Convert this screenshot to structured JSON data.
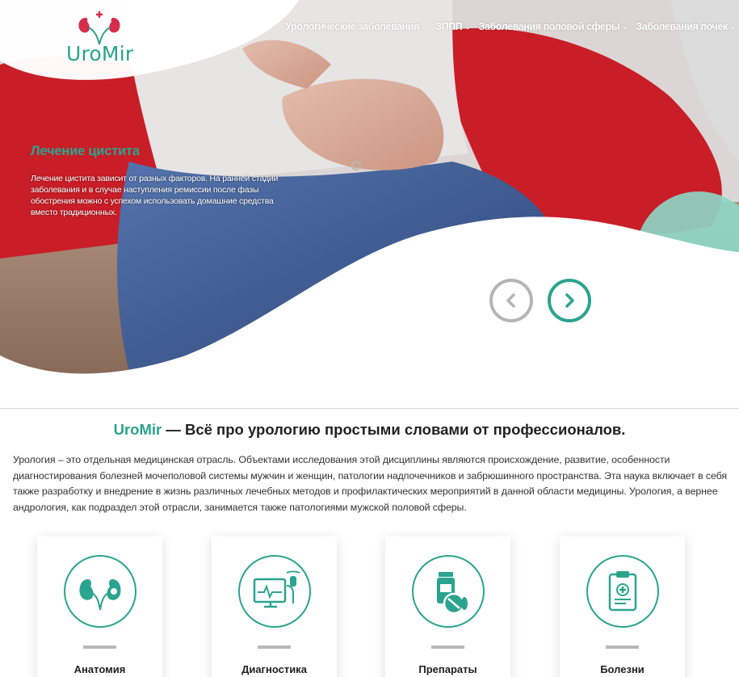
{
  "brand": {
    "logo_text": "UroMir"
  },
  "nav": {
    "items": [
      {
        "label": "Урологические заболевания"
      },
      {
        "label": "ЗППП"
      },
      {
        "label": "Заболевания половой сферы"
      },
      {
        "label": "Заболевания почек"
      }
    ]
  },
  "slider": {
    "title": "Лечение цистита",
    "text": "Лечение цистита зависит от разных факторов. На ранней стадии заболевания и в случае наступления ремиссии после фазы обострения можно с успехом использовать домашние средства вместо традиционных."
  },
  "main": {
    "headline_brand": "UroMir",
    "headline_rest": " — Всё про урологию простыми словами от профессионалов.",
    "intro": "Урология – это отдельная медицинская отрасль. Объектами исследования этой дисциплины являются происхождение, развитие, особенности диагностирования болезней мочеполовой системы мужчин и женщин, патологии надпочечников и забрюшинного пространства. Эта наука включает в себя также разработку и внедрение в жизнь различных лечебных методов и профилактических мероприятий в данной области медицины. Урология, а вернее андрология, как подраздел этой отрасли, занимается также патологиями мужской половой сферы."
  },
  "cards": [
    {
      "label": "Анатомия",
      "icon": "kidneys-icon"
    },
    {
      "label": "Диагностика",
      "icon": "ultrasound-monitor-icon"
    },
    {
      "label": "Препараты",
      "icon": "pills-icon"
    },
    {
      "label": "Болезни",
      "icon": "clipboard-icon"
    }
  ],
  "colors": {
    "accent": "#2aa48f",
    "muted_arrow": "#b5b5b5",
    "hero_red": "#d61f2a",
    "jeans": "#4465a0"
  }
}
